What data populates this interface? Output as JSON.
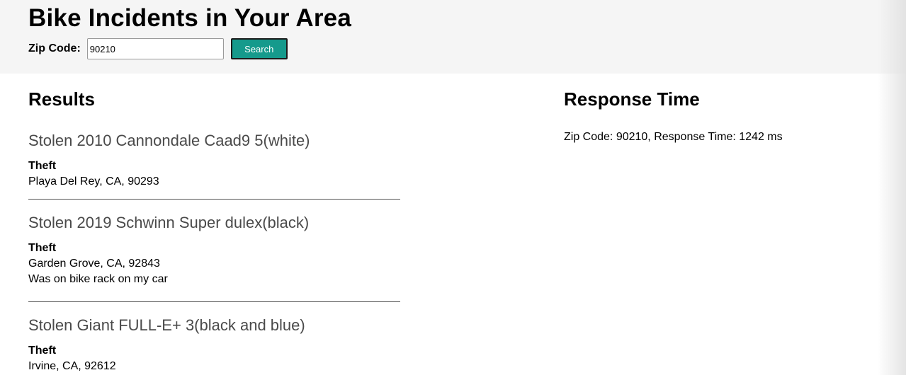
{
  "header": {
    "title": "Bike Incidents in Your Area",
    "zip_label": "Zip Code:",
    "zip_value": "90210",
    "search_label": "Search"
  },
  "results": {
    "heading": "Results",
    "incidents": [
      {
        "title": "Stolen 2010 Cannondale Caad9 5(white)",
        "type": "Theft",
        "location": "Playa Del Rey, CA, 90293"
      },
      {
        "title": "Stolen 2019 Schwinn Super dulex(black)",
        "type": "Theft",
        "location": "Garden Grove, CA, 92843",
        "description": "Was on bike rack on my car"
      },
      {
        "title": "Stolen Giant FULL-E+ 3(black and blue)",
        "type": "Theft",
        "location": "Irvine, CA, 92612"
      }
    ]
  },
  "response": {
    "heading": "Response Time",
    "summary": "Zip Code: 90210, Response Time: 1242 ms"
  },
  "colors": {
    "header_bg": "#f5f5f5",
    "button_bg": "#159a8c",
    "title_text": "#4a4a4a"
  }
}
